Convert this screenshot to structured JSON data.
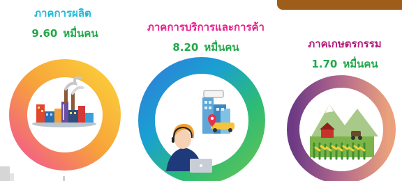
{
  "banner_text": "",
  "chart_data": {
    "type": "pie",
    "categories": [
      "ภาคการผลิต",
      "ภาคการบริการและการค้า",
      "ภาคเกษตรกรรม"
    ],
    "values": [
      9.6,
      8.2,
      1.7
    ],
    "value_labels": [
      "9.60",
      "8.20",
      "1.70"
    ],
    "unit": "หมื่นคน",
    "colors": {
      "manufacturing_title": "#1db9d8",
      "service_title": "#e8208a",
      "agriculture_title": "#b2187b",
      "value_text": "#21a84a"
    }
  },
  "gradients": {
    "manufacturing": [
      "#f25a8c",
      "#f7a33a",
      "#fbd03a"
    ],
    "service": [
      "#2e7fd8",
      "#1aa0d2",
      "#2dbb75",
      "#61c456"
    ],
    "agriculture": [
      "#6e3a86",
      "#b46a8b",
      "#eba27c"
    ]
  },
  "icons": {
    "manufacturing": "factory-icon",
    "service": "call-center-city-icon",
    "agriculture": "farm-icon"
  }
}
